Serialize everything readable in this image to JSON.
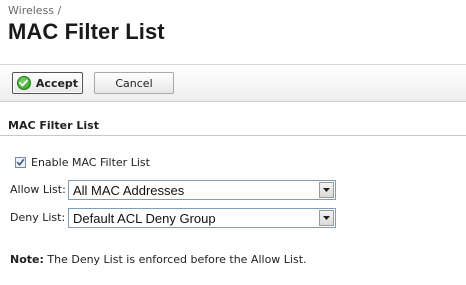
{
  "breadcrumb": "Wireless /",
  "page_title": "MAC Filter List",
  "toolbar": {
    "accept_label": "Accept",
    "cancel_label": "Cancel"
  },
  "section": {
    "title": "MAC Filter List",
    "enable_checkbox": {
      "label": "Enable MAC Filter List",
      "checked": true
    },
    "allow_list": {
      "label": "Allow List:",
      "value": "All MAC Addresses"
    },
    "deny_list": {
      "label": "Deny List:",
      "value": "Default ACL Deny Group"
    }
  },
  "note": {
    "prefix": "Note:",
    "text": " The Deny List is enforced before the Allow List."
  },
  "icons": {
    "accept": "checkmark-icon",
    "dropdown": "dropdown-arrow-icon",
    "checkbox": "checkmark-icon"
  }
}
